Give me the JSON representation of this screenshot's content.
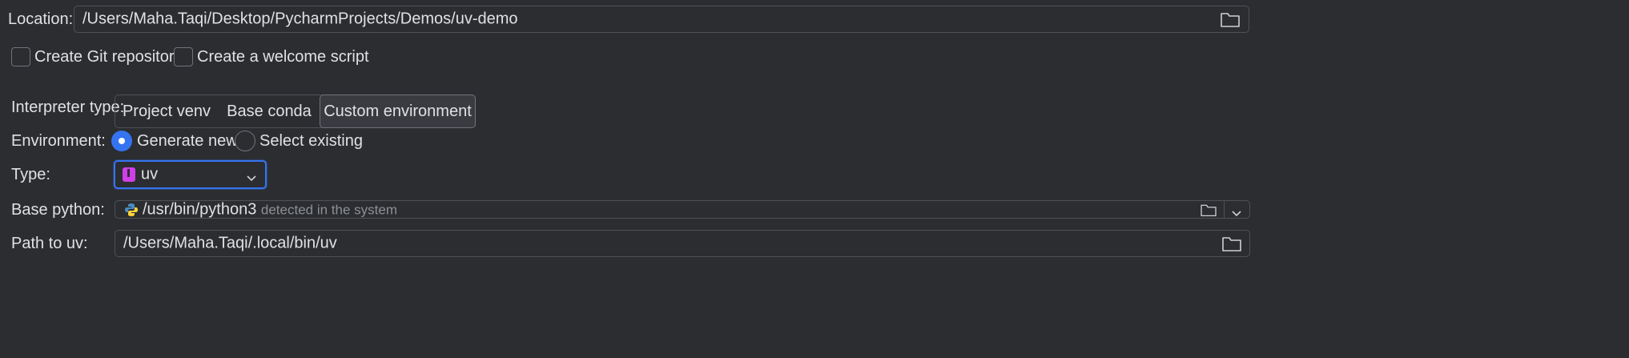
{
  "location": {
    "label": "Location:",
    "value": "/Users/Maha.Taqi/Desktop/PycharmProjects/Demos/uv-demo"
  },
  "checkboxes": {
    "git": "Create Git repository",
    "welcome": "Create a welcome script"
  },
  "interpreter": {
    "label": "Interpreter type:",
    "options": [
      "Project venv",
      "Base conda",
      "Custom environment"
    ],
    "selected": "Custom environment"
  },
  "environment": {
    "label": "Environment:",
    "generate": "Generate new",
    "select": "Select existing",
    "selected": "Generate new"
  },
  "type": {
    "label": "Type:",
    "value": "uv"
  },
  "base_python": {
    "label": "Base python:",
    "value": "/usr/bin/python3",
    "hint": "detected in the system"
  },
  "path_uv": {
    "label": "Path to uv:",
    "value": "/Users/Maha.Taqi/.local/bin/uv"
  },
  "colors": {
    "background": "#2b2d30",
    "accent": "#3574f0",
    "uv_icon": "#d03ee8"
  }
}
